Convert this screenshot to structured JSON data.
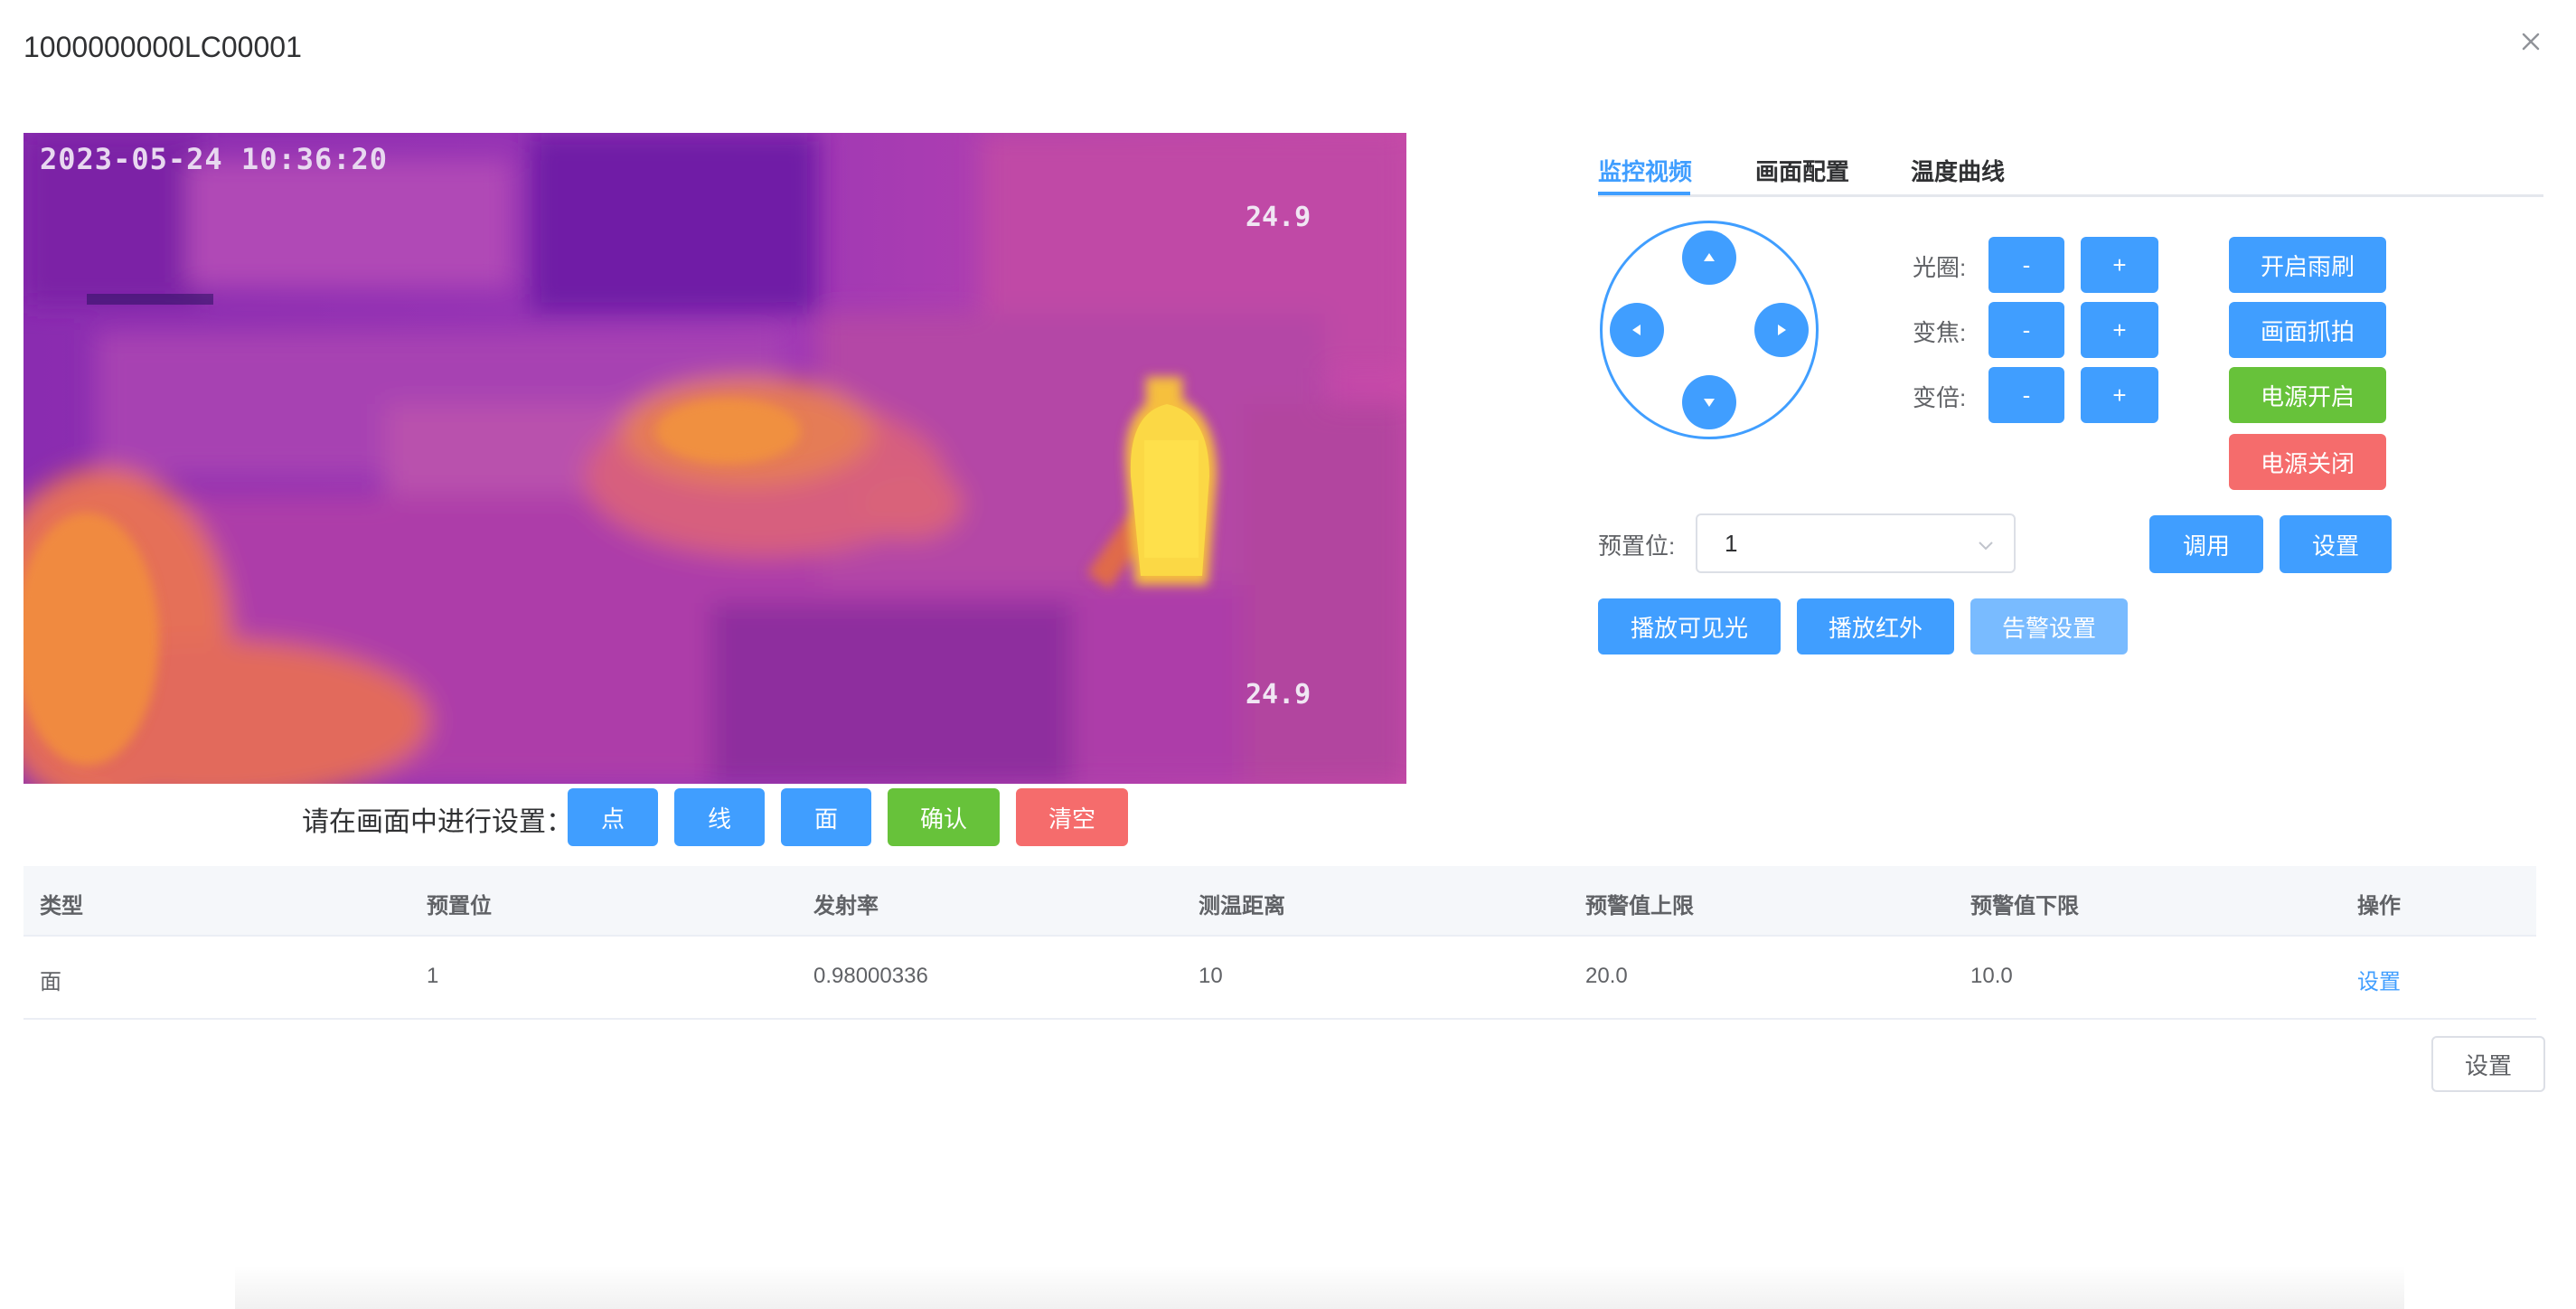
{
  "dialog": {
    "title": "1000000000LC00001",
    "close_icon": "close-icon"
  },
  "video": {
    "timestamp": "2023-05-24 10:36:20",
    "temp_top": "24.9",
    "temp_bottom": "24.9"
  },
  "draw_toolbar": {
    "hint": "请在画面中进行设置：",
    "point_label": "点",
    "line_label": "线",
    "area_label": "面",
    "confirm_label": "确认",
    "clear_label": "清空"
  },
  "tabs": [
    {
      "label": "监控视频",
      "active": true
    },
    {
      "label": "画面配置",
      "active": false
    },
    {
      "label": "温度曲线",
      "active": false
    }
  ],
  "ptz": {
    "up_icon": "caret-up-icon",
    "down_icon": "caret-down-icon",
    "left_icon": "caret-left-icon",
    "right_icon": "caret-right-icon"
  },
  "controls": {
    "iris_label": "光圈:",
    "focus_label": "变焦:",
    "zoom_label": "变倍:",
    "minus": "-",
    "plus": "+"
  },
  "actions": {
    "wiper_on": "开启雨刷",
    "snapshot": "画面抓拍",
    "power_on": "电源开启",
    "power_off": "电源关闭"
  },
  "preset": {
    "label": "预置位:",
    "value": "1",
    "call_label": "调用",
    "set_label": "设置"
  },
  "playback": {
    "visible_label": "播放可见光",
    "infrared_label": "播放红外",
    "alarm_label": "告警设置"
  },
  "table": {
    "headers": [
      "类型",
      "预置位",
      "发射率",
      "测温距离",
      "预警值上限",
      "预警值下限",
      "操作"
    ],
    "rows": [
      {
        "type": "面",
        "preset": "1",
        "emissivity": "0.98000336",
        "distance": "10",
        "upper": "20.0",
        "lower": "10.0",
        "action": "设置"
      }
    ]
  },
  "footer": {
    "set_label": "设置"
  },
  "colors": {
    "primary": "#409eff",
    "success": "#67c23a",
    "danger": "#f56c6c",
    "primary_light": "#79bbff"
  }
}
